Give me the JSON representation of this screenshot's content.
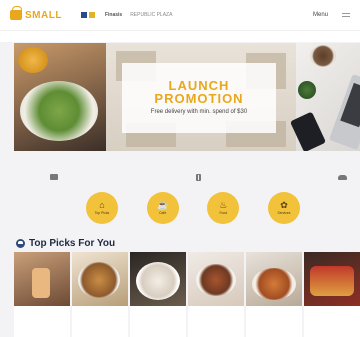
{
  "header": {
    "logo_text": "SMALL",
    "logo_sub": "",
    "partner_logos": [
      "",
      "Finasis",
      "REPUBLIC PLAZA"
    ],
    "menu_label": "Menu"
  },
  "notice": "",
  "hero": {
    "title": "LAUNCH PROMOTION",
    "subtitle": "Free delivery with min. spend of $30",
    "fine_print": ""
  },
  "info_strip": [
    {
      "icon": "truck-icon",
      "text": ""
    },
    {
      "icon": "hourglass-icon",
      "text": ""
    },
    {
      "icon": "car-icon",
      "text": ""
    }
  ],
  "categories": [
    {
      "icon": "basket-icon",
      "label": "Top Picks"
    },
    {
      "icon": "cup-icon",
      "label": "Café"
    },
    {
      "icon": "food-icon",
      "label": "Food"
    },
    {
      "icon": "grocery-icon",
      "label": "Services"
    }
  ],
  "top_picks": {
    "title": "Top Picks For You",
    "cards": [
      {
        "brand": "",
        "name": "",
        "price": ""
      },
      {
        "brand": "",
        "name": "",
        "price": ""
      },
      {
        "brand": "",
        "name": "",
        "price": ""
      },
      {
        "brand": "",
        "name": "",
        "price": ""
      },
      {
        "brand": "",
        "name": "",
        "price": ""
      },
      {
        "brand": "",
        "name": "",
        "price": ""
      }
    ]
  },
  "colors": {
    "accent": "#e9a81c",
    "category_circle": "#f2c23a",
    "heading": "#1e2a44",
    "brand_link": "#2f5fb0"
  }
}
